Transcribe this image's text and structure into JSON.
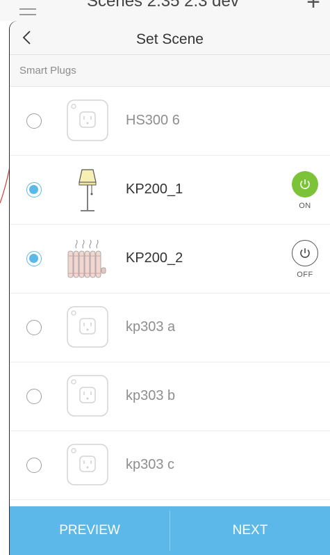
{
  "background": {
    "title": "Scenes 2.35 2.3 dev"
  },
  "header": {
    "title": "Set Scene"
  },
  "section": {
    "label": "Smart Plugs"
  },
  "devices": [
    {
      "name": "HS300 6",
      "selected": false,
      "icon": "plug-icon"
    },
    {
      "name": "KP200_1",
      "selected": true,
      "icon": "floor-lamp-icon",
      "power_label": "ON",
      "power_icon": "power-on-icon"
    },
    {
      "name": "KP200_2",
      "selected": true,
      "icon": "radiator-heater-icon",
      "power_label": "OFF",
      "power_icon": "power-off-icon"
    },
    {
      "name": "kp303 a",
      "selected": false,
      "icon": "plug-icon"
    },
    {
      "name": "kp303 b",
      "selected": false,
      "icon": "plug-icon"
    },
    {
      "name": "kp303 c",
      "selected": false,
      "icon": "plug-icon"
    }
  ],
  "footer": {
    "preview_label": "PREVIEW",
    "next_label": "NEXT"
  },
  "colors": {
    "accent": "#5bb8e8",
    "power_on": "#7cc33a",
    "text_dim": "#8e8e8e",
    "text_dark": "#333333"
  }
}
